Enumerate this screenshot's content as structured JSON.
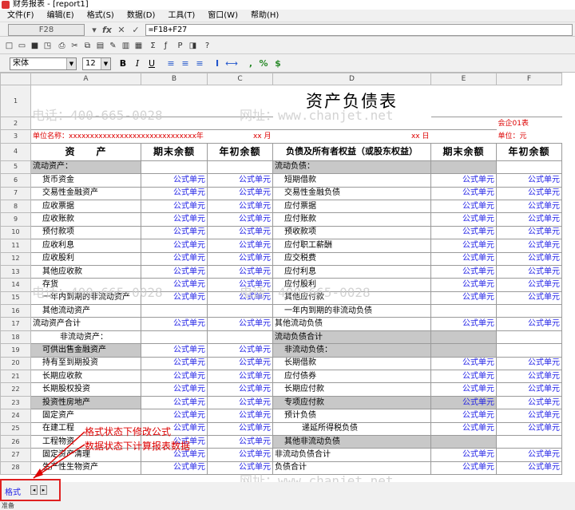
{
  "window": {
    "title": "财务报表 - [report1]"
  },
  "menu": [
    "文件(F)",
    "编辑(E)",
    "格式(S)",
    "数据(D)",
    "工具(T)",
    "窗口(W)",
    "帮助(H)"
  ],
  "formula": {
    "cell_ref": "F28",
    "value": "=F18+F27",
    "fx_label": "fx",
    "cancel_label": "✕",
    "confirm_label": "✓"
  },
  "toolbar": {
    "icons": [
      "new-file",
      "open-folder",
      "save",
      "print-preview",
      "print",
      "cut",
      "copy",
      "paste",
      "format-painter",
      "insert-row",
      "delete-row",
      "sum",
      "insert-function",
      "pivot",
      "toggle-view",
      "help-pointer"
    ],
    "glyphs": [
      "□",
      "▭",
      "■",
      "◳",
      "⎙",
      "✂",
      "⧉",
      "▤",
      "✎",
      "▥",
      "▦",
      "Σ",
      "ƒ",
      "P",
      "◨",
      "?"
    ]
  },
  "format_bar": {
    "font_name": "宋体",
    "font_size": "12",
    "bold_label": "B",
    "italic_label": "I",
    "underline_label": "U",
    "align_glyphs": [
      "≡",
      "≡",
      "≡",
      "I",
      "⟷"
    ],
    "comma_label": ",",
    "percent_label": "%",
    "currency_label": "$"
  },
  "sheet": {
    "columns": [
      "A",
      "B",
      "C",
      "D",
      "E",
      "F"
    ],
    "title": "资产负债表",
    "form_code": "会企01表",
    "unit": "单位：元",
    "company_label": "单位名称：xxxxxxxxxxxxxxxxxxxxxxxxxxxxxx年",
    "month_label": "xx 月",
    "day_label": "xx 日",
    "headers": [
      "资　　产",
      "期末余额",
      "年初余额",
      "负债及所有者权益（或股东权益）",
      "期末余额",
      "年初余额"
    ],
    "formula_cell": "公式单元",
    "rows": [
      {
        "n": "5",
        "a": "流动资产：",
        "a_style": "lbl",
        "b": "",
        "c": "",
        "d": "流动负债：",
        "d_style": "lbl",
        "e": "",
        "f": "",
        "gray": true
      },
      {
        "n": "6",
        "a": "货币资金",
        "a_style": "ind",
        "b": "公式单元",
        "c": "公式单元",
        "d": "短期借款",
        "d_style": "ind",
        "e": "公式单元",
        "f": "公式单元"
      },
      {
        "n": "7",
        "a": "交易性金融资产",
        "a_style": "ind",
        "b": "公式单元",
        "c": "公式单元",
        "d": "交易性金融负债",
        "d_style": "ind",
        "e": "公式单元",
        "f": "公式单元"
      },
      {
        "n": "8",
        "a": "应收票据",
        "a_style": "ind",
        "b": "公式单元",
        "c": "公式单元",
        "d": "应付票据",
        "d_style": "ind",
        "e": "公式单元",
        "f": "公式单元"
      },
      {
        "n": "9",
        "a": "应收账款",
        "a_style": "ind",
        "b": "公式单元",
        "c": "公式单元",
        "d": "应付账款",
        "d_style": "ind",
        "e": "公式单元",
        "f": "公式单元"
      },
      {
        "n": "10",
        "a": "预付款项",
        "a_style": "ind",
        "b": "公式单元",
        "c": "公式单元",
        "d": "预收款项",
        "d_style": "ind",
        "e": "公式单元",
        "f": "公式单元"
      },
      {
        "n": "11",
        "a": "应收利息",
        "a_style": "ind",
        "b": "公式单元",
        "c": "公式单元",
        "d": "应付职工薪酬",
        "d_style": "ind",
        "e": "公式单元",
        "f": "公式单元"
      },
      {
        "n": "12",
        "a": "应收股利",
        "a_style": "ind",
        "b": "公式单元",
        "c": "公式单元",
        "d": "应交税费",
        "d_style": "ind",
        "e": "公式单元",
        "f": "公式单元"
      },
      {
        "n": "13",
        "a": "其他应收款",
        "a_style": "ind",
        "b": "公式单元",
        "c": "公式单元",
        "d": "应付利息",
        "d_style": "ind",
        "e": "公式单元",
        "f": "公式单元"
      },
      {
        "n": "14",
        "a": "存货",
        "a_style": "ind",
        "b": "公式单元",
        "c": "公式单元",
        "d": "应付股利",
        "d_style": "ind",
        "e": "公式单元",
        "f": "公式单元"
      },
      {
        "n": "15",
        "a": "一年内到期的非流动资产",
        "a_style": "ind",
        "b": "公式单元",
        "c": "公式单元",
        "d": "其他应付款",
        "d_style": "ind",
        "e": "公式单元",
        "f": "公式单元"
      },
      {
        "n": "16",
        "a": "其他流动资产",
        "a_style": "ind",
        "b": "",
        "c": "",
        "d": "一年内到期的非流动负债",
        "d_style": "ind",
        "e": "",
        "f": ""
      },
      {
        "n": "17",
        "a": "流动资产合计",
        "a_style": "lbl",
        "b": "公式单元",
        "c": "公式单元",
        "d": "其他流动负债",
        "d_style": "lbl",
        "e": "公式单元",
        "f": "公式单元"
      },
      {
        "n": "18",
        "a": "非流动资产：",
        "a_style": "ind2",
        "b": "",
        "c": "",
        "d": "流动负债合计",
        "d_style": "lbl",
        "e": "",
        "f": "",
        "gray": true
      },
      {
        "n": "19",
        "a": "可供出售金融资产",
        "a_style": "ind",
        "b": "公式单元",
        "c": "公式单元",
        "d": "非流动负债：",
        "d_style": "ind",
        "e": "",
        "f": "",
        "gray": true
      },
      {
        "n": "20",
        "a": "持有至到期投资",
        "a_style": "ind",
        "b": "公式单元",
        "c": "公式单元",
        "d": "长期借款",
        "d_style": "ind",
        "e": "公式单元",
        "f": "公式单元"
      },
      {
        "n": "21",
        "a": "长期应收款",
        "a_style": "ind",
        "b": "公式单元",
        "c": "公式单元",
        "d": "应付债券",
        "d_style": "ind",
        "e": "公式单元",
        "f": "公式单元"
      },
      {
        "n": "22",
        "a": "长期股权投资",
        "a_style": "ind",
        "b": "公式单元",
        "c": "公式单元",
        "d": "长期应付款",
        "d_style": "ind",
        "e": "公式单元",
        "f": "公式单元"
      },
      {
        "n": "23",
        "a": "投资性房地产",
        "a_style": "ind",
        "b": "公式单元",
        "c": "公式单元",
        "d": "专项应付款",
        "d_style": "ind",
        "e": "公式单元",
        "f": "公式单元",
        "gray": true
      },
      {
        "n": "24",
        "a": "固定资产",
        "a_style": "ind",
        "b": "公式单元",
        "c": "公式单元",
        "d": "预计负债",
        "d_style": "ind",
        "e": "公式单元",
        "f": "公式单元"
      },
      {
        "n": "25",
        "a": "在建工程",
        "a_style": "ind",
        "b": "公式单元",
        "c": "公式单元",
        "d": "递延所得税负债",
        "d_style": "ind2",
        "e": "公式单元",
        "f": "公式单元"
      },
      {
        "n": "26",
        "a": "工程物资",
        "a_style": "ind",
        "b": "公式单元",
        "c": "公式单元",
        "d": "其他非流动负债",
        "d_style": "ind",
        "e": "",
        "f": "",
        "gray": true
      },
      {
        "n": "27",
        "a": "固定资产清理",
        "a_style": "ind",
        "b": "公式单元",
        "c": "公式单元",
        "d": "非流动负债合计",
        "d_style": "lbl",
        "e": "公式单元",
        "f": "公式单元"
      },
      {
        "n": "28",
        "a": "生产性生物资产",
        "a_style": "ind",
        "b": "公式单元",
        "c": "公式单元",
        "d": "负债合计",
        "d_style": "lbl",
        "e": "公式单元",
        "f": "公式单元"
      }
    ]
  },
  "annotations": {
    "line1": "格式状态下修改公式",
    "line2": "数据状态下计算报表数据"
  },
  "watermark": {
    "phone": "电话：400-665-0028",
    "site": "网址：www.chanjet.net"
  },
  "mode": {
    "label": "格式",
    "prev": "◂",
    "next": "▸"
  },
  "status": {
    "text": "准备"
  }
}
